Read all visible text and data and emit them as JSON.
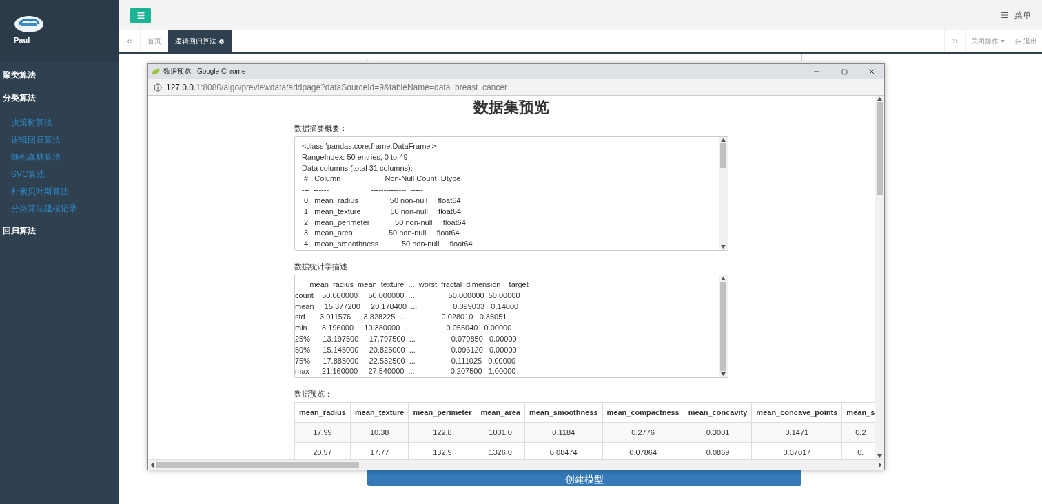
{
  "sidebar": {
    "user": "Paul",
    "menu": [
      {
        "label": "聚类算法"
      },
      {
        "label": "分类算法",
        "children": [
          {
            "label": "决策树算法"
          },
          {
            "label": "逻辑回归算法"
          },
          {
            "label": "随机森林算法"
          },
          {
            "label": "SVC算法"
          },
          {
            "label": "朴素贝叶斯算法"
          },
          {
            "label": "分类算法建模记录"
          }
        ]
      },
      {
        "label": "回归算法"
      }
    ]
  },
  "header": {
    "menu_label": "菜单"
  },
  "tabs": [
    {
      "label": "首页",
      "selected": false
    },
    {
      "label": "逻辑回归算法",
      "selected": true
    }
  ],
  "tab_actions": {
    "close_ops": "关闭操作",
    "logout": "退出"
  },
  "page": {
    "create_button": "创建模型"
  },
  "popup": {
    "title": "数据预览 - Google Chrome",
    "url_host": "127.0.0.1",
    "url_rest": ":8080/algo/previewdata/addpage?dataSourceId=9&tableName=data_breast_cancer",
    "heading": "数据集预览",
    "summary": {
      "label": "数据摘要概要：",
      "lines": [
        "<class 'pandas.core.frame.DataFrame'>",
        "RangeIndex: 50 entries, 0 to 49",
        "Data columns (total 31 columns):",
        " #   Column                     Non-Null Count  Dtype",
        "---  ------                    --------------  -----",
        " 0   mean_radius               50 non-null     float64",
        " 1   mean_texture              50 non-null     float64",
        " 2   mean_perimeter            50 non-null     float64",
        " 3   mean_area                 50 non-null     float64",
        " 4   mean_smoothness           50 non-null     float64"
      ]
    },
    "stats": {
      "label": "数据统计学描述：",
      "lines": [
        "       mean_radius  mean_texture  ...  worst_fractal_dimension    target",
        "count    50.000000     50.000000  ...                50.000000  50.00000",
        "mean     15.377200     20.178400  ...                 0.099033   0.14000",
        "std       3.011576      3.828225  ...                 0.028010   0.35051",
        "min       8.196000     10.380000  ...                 0.055040   0.00000",
        "25%      13.197500     17.797500  ...                 0.079850   0.00000",
        "50%      15.145000     20.825000  ...                 0.096120   0.00000",
        "75%      17.885000     22.532500  ...                 0.111025   0.00000",
        "max      21.160000     27.540000  ...                 0.207500   1.00000"
      ]
    },
    "preview": {
      "label": "数据预览：",
      "columns": [
        "mean_radius",
        "mean_texture",
        "mean_perimeter",
        "mean_area",
        "mean_smoothness",
        "mean_compactness",
        "mean_concavity",
        "mean_concave_points",
        "mean_s"
      ],
      "rows": [
        [
          "17.99",
          "10.38",
          "122.8",
          "1001.0",
          "0.1184",
          "0.2776",
          "0.3001",
          "0.1471",
          "0.2"
        ],
        [
          "20.57",
          "17.77",
          "132.9",
          "1326.0",
          "0.08474",
          "0.07864",
          "0.0869",
          "0.07017",
          "0."
        ]
      ]
    }
  }
}
